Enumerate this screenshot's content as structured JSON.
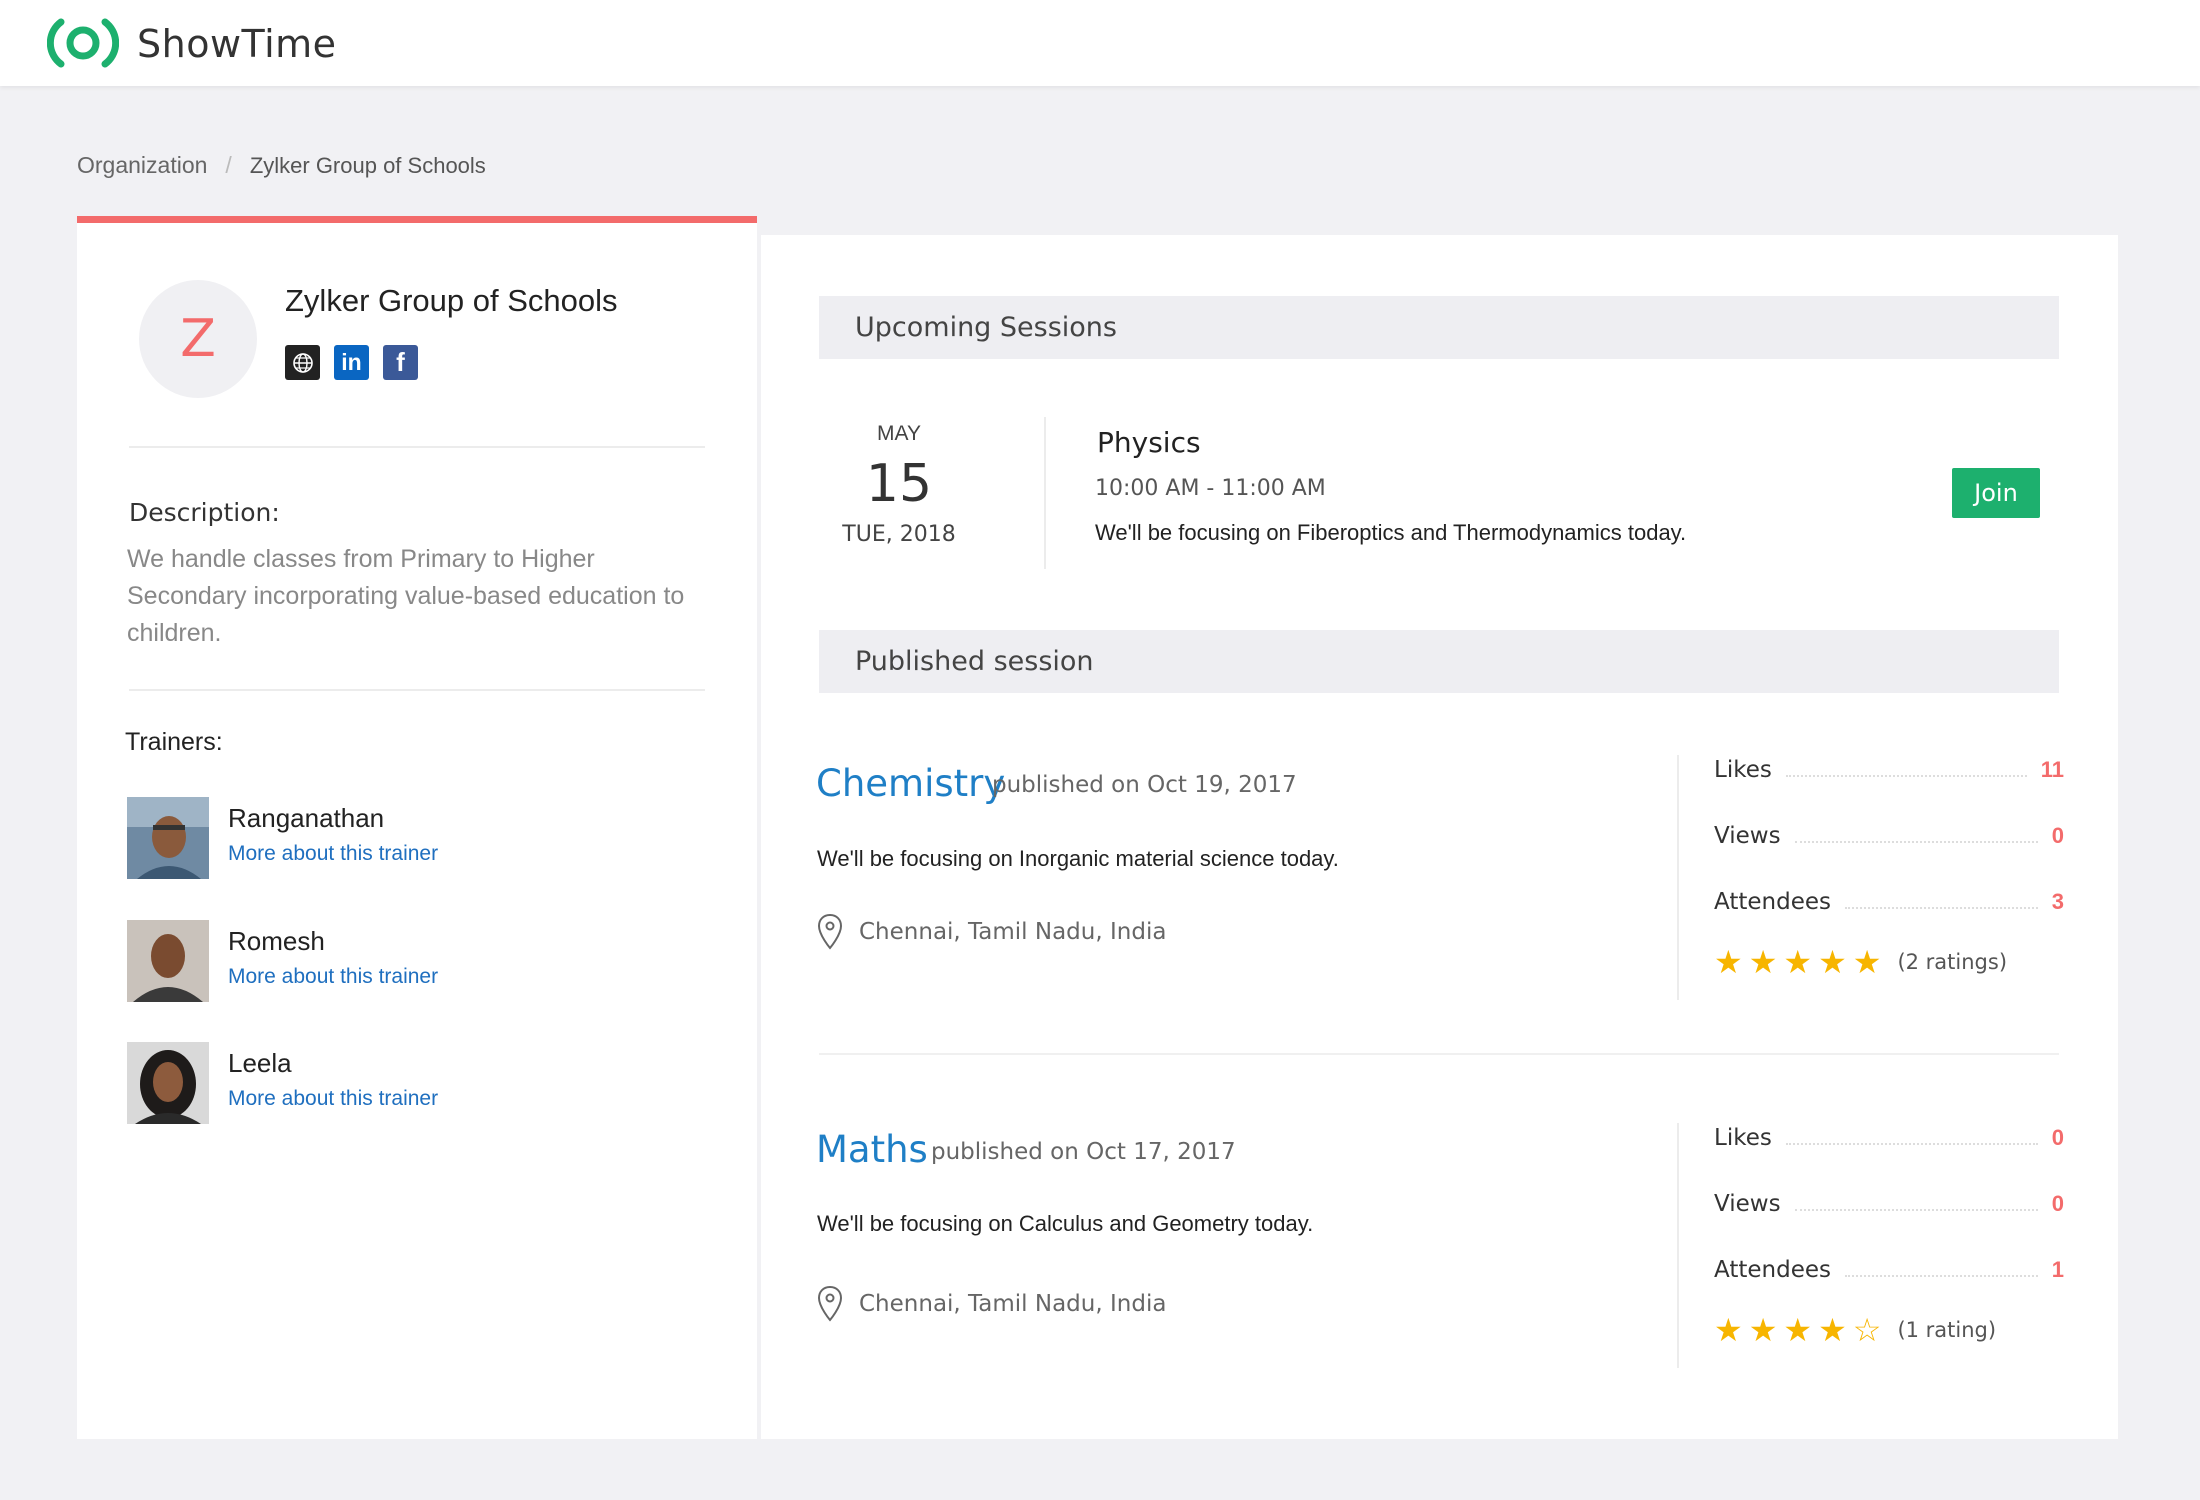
{
  "app": {
    "name": "ShowTime",
    "accent": "#1db06e"
  },
  "breadcrumb": {
    "root": "Organization",
    "separator": "/",
    "current": "Zylker Group of Schools"
  },
  "org": {
    "initial": "Z",
    "name": "Zylker Group of Schools",
    "socials": [
      {
        "id": "website",
        "icon": "globe-icon",
        "glyph": "🌐"
      },
      {
        "id": "linkedin",
        "icon": "linkedin-icon",
        "glyph": "in"
      },
      {
        "id": "facebook",
        "icon": "facebook-icon",
        "glyph": "f"
      }
    ],
    "description_label": "Description:",
    "description": "We handle classes from Primary to Higher Secondary incorporating value-based education to children.",
    "trainers_label": "Trainers:",
    "trainers": [
      {
        "name": "Ranganathan",
        "link": "More about this trainer"
      },
      {
        "name": "Romesh",
        "link": "More about this trainer"
      },
      {
        "name": "Leela",
        "link": "More about this trainer"
      }
    ]
  },
  "upcoming": {
    "heading": "Upcoming Sessions",
    "session": {
      "month": "MAY",
      "day": "15",
      "weekday_year": "TUE, 2018",
      "title": "Physics",
      "time": "10:00 AM - 11:00 AM",
      "description": "We'll be focusing on Fiberoptics and Thermodynamics today.",
      "join_label": "Join"
    }
  },
  "published": {
    "heading": "Published session",
    "sessions": [
      {
        "title": "Chemistry",
        "published": "published on Oct 19, 2017",
        "description": "We'll be focusing on Inorganic material science today.",
        "location": "Chennai, Tamil Nadu, India",
        "likes_label": "Likes",
        "likes": "11",
        "views_label": "Views",
        "views": "0",
        "attendees_label": "Attendees",
        "attendees": "3",
        "stars": 5,
        "rating_text": "(2 ratings)"
      },
      {
        "title": "Maths",
        "published": "published on Oct 17, 2017",
        "description": "We'll be focusing on Calculus and Geometry today.",
        "location": "Chennai, Tamil Nadu, India",
        "likes_label": "Likes",
        "likes": "0",
        "views_label": "Views",
        "views": "0",
        "attendees_label": "Attendees",
        "attendees": "1",
        "stars": 4,
        "rating_text": "(1 rating)"
      }
    ]
  }
}
